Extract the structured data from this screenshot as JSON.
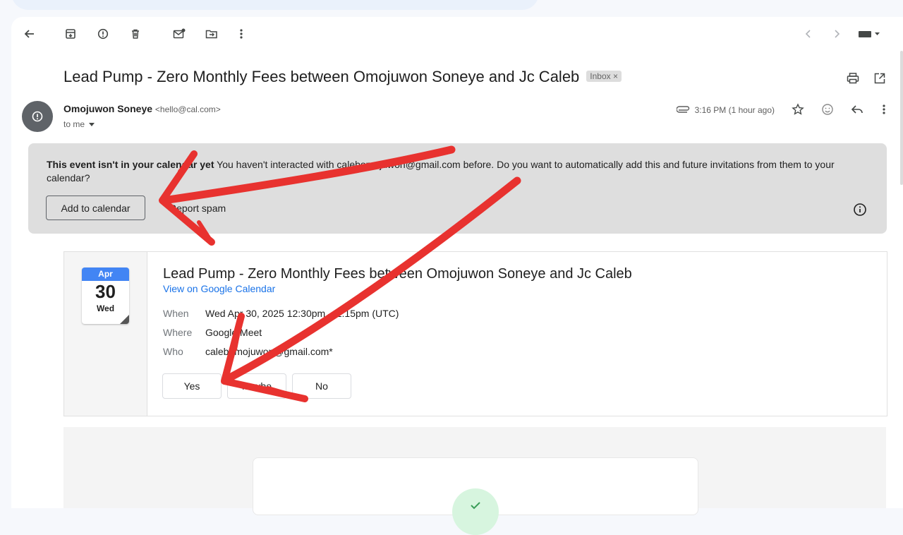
{
  "toolbar": {
    "back_icon": "arrow-left-icon",
    "archive_icon": "archive-icon",
    "spam_icon": "report-icon",
    "delete_icon": "trash-icon",
    "unread_icon": "mark-unread-icon",
    "move_icon": "move-to-folder-icon",
    "more_icon": "more-vert-icon",
    "prev_icon": "chevron-left-icon",
    "next_icon": "chevron-right-icon",
    "input_tools_icon": "keyboard-icon"
  },
  "email": {
    "subject": "Lead Pump - Zero Monthly Fees between Omojuwon Soneye and Jc Caleb",
    "label": "Inbox",
    "sender_name": "Omojuwon Soneye",
    "sender_email": "<hello@cal.com>",
    "recipient": "to me",
    "time": "3:16 PM (1 hour ago)"
  },
  "banner": {
    "title": "This event isn't in your calendar yet",
    "message": "You haven't interacted with calebomojuwon@gmail.com before. Do you want to automatically add this and future invitations from them to your calendar?",
    "add_button": "Add to calendar",
    "report_spam": "Report spam"
  },
  "invite": {
    "month": "Apr",
    "day": "30",
    "weekday": "Wed",
    "title": "Lead Pump - Zero Monthly Fees between Omojuwon Soneye and Jc Caleb",
    "calendar_link": "View on Google Calendar",
    "when_label": "When",
    "when_value": "Wed Apr 30, 2025 12:30pm – 1:15pm (UTC)",
    "where_label": "Where",
    "where_value": "Google Meet",
    "who_label": "Who",
    "who_value": "calebomojuwon@gmail.com*",
    "rsvp": [
      "Yes",
      "Maybe",
      "No"
    ]
  },
  "colors": {
    "accent_blue": "#1a73e8",
    "calendar_blue": "#4285f4",
    "banner_bg": "#dedede",
    "annotation_red": "#e8322f"
  }
}
